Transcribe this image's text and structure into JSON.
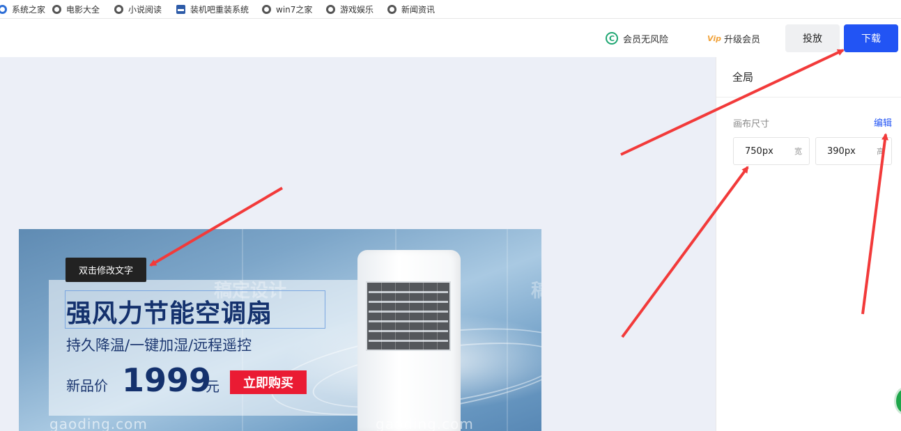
{
  "bookmarks": [
    {
      "label": "系统之家",
      "icon": "globe-icon"
    },
    {
      "label": "电影大全",
      "icon": "globe-icon"
    },
    {
      "label": "小说阅读",
      "icon": "globe-icon"
    },
    {
      "label": "装机吧重装系统",
      "icon": "site-logo-icon"
    },
    {
      "label": "win7之家",
      "icon": "globe-icon"
    },
    {
      "label": "游戏娱乐",
      "icon": "globe-icon"
    },
    {
      "label": "新闻资讯",
      "icon": "globe-icon"
    }
  ],
  "toolbar": {
    "member_safe": "会员无风险",
    "member_safe_icon": "C",
    "upgrade": "升级会员",
    "upgrade_icon": "Vip",
    "publish": "投放",
    "download": "下载"
  },
  "panel": {
    "title": "全局",
    "size_label": "画布尺寸",
    "edit": "编辑",
    "width_value": "750px",
    "width_unit": "宽",
    "height_value": "390px",
    "height_unit": "高"
  },
  "banner": {
    "tooltip": "双击修改文字",
    "headline": "强风力节能空调扇",
    "subline": "持久降温/一键加湿/远程遥控",
    "price_label": "新品价",
    "price": "1999",
    "currency": "元",
    "buy": "立即购买",
    "watermark": "gaoding.com",
    "watermark_cn": "稿定设计"
  },
  "colors": {
    "accent": "#2254f4",
    "buy_button": "#ea1b33",
    "arrow": "#f23a3a",
    "headline": "#14316d"
  }
}
